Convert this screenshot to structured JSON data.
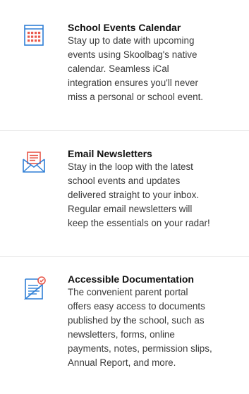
{
  "features": [
    {
      "icon": "calendar-icon",
      "title": "School Events Calendar",
      "lines": [
        "Stay up to date with upcoming",
        "events using Skoolbag's native",
        "calendar. Seamless iCal",
        "integration ensures you'll never",
        "miss a personal or school event."
      ]
    },
    {
      "icon": "envelope-icon",
      "title": "Email Newsletters",
      "lines": [
        "Stay in the loop with the latest",
        "school events and updates",
        "delivered straight to your inbox.",
        "Regular email newsletters will",
        "keep the essentials on your radar!"
      ]
    },
    {
      "icon": "document-check-icon",
      "title": "Accessible Documentation",
      "lines": [
        "The convenient parent portal",
        "offers easy access to documents",
        "published by the school, such as",
        "newsletters, forms, online",
        "payments, notes, permission slips,",
        "Annual Report, and more."
      ]
    }
  ],
  "colors": {
    "icon_blue": "#2f7fd6",
    "icon_red": "#e8584b",
    "divider": "#e4e4e4"
  }
}
